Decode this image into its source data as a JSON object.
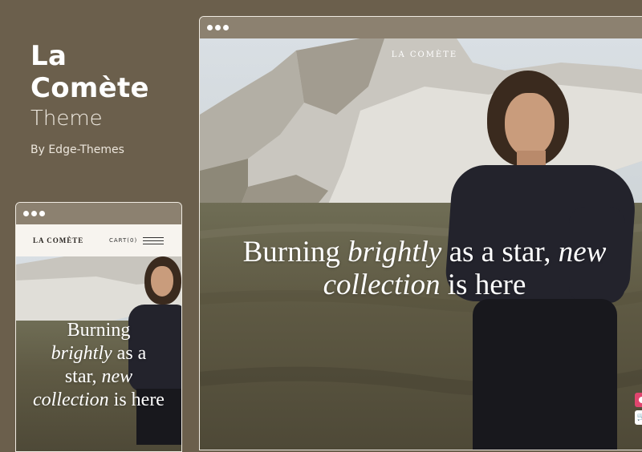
{
  "promo": {
    "title_line1": "La",
    "title_line2": "Comète",
    "subtitle": "Theme",
    "byline": "By Edge-Themes"
  },
  "desktop": {
    "logo": "LA COMÈTE",
    "headline_part1": "Burning ",
    "headline_em1": "brightly",
    "headline_part2": " as a star, ",
    "headline_em2": "new",
    "headline_em3": "collection",
    "headline_part3": " is here"
  },
  "mobile": {
    "logo": "LA COMÈTE",
    "cart": "CART(0)",
    "headline_line1": "Burning",
    "headline_em1": "brightly",
    "headline_line2": " as a",
    "headline_line3": "star, ",
    "headline_em2": "new",
    "headline_em3": "collection",
    "headline_line4": " is here"
  },
  "widgets": {
    "top_icon": "target-icon",
    "bottom_icon": "cart-icon"
  },
  "colors": {
    "background": "#6b5f4c",
    "frame": "#8c8170",
    "accent": "#e0456e"
  }
}
